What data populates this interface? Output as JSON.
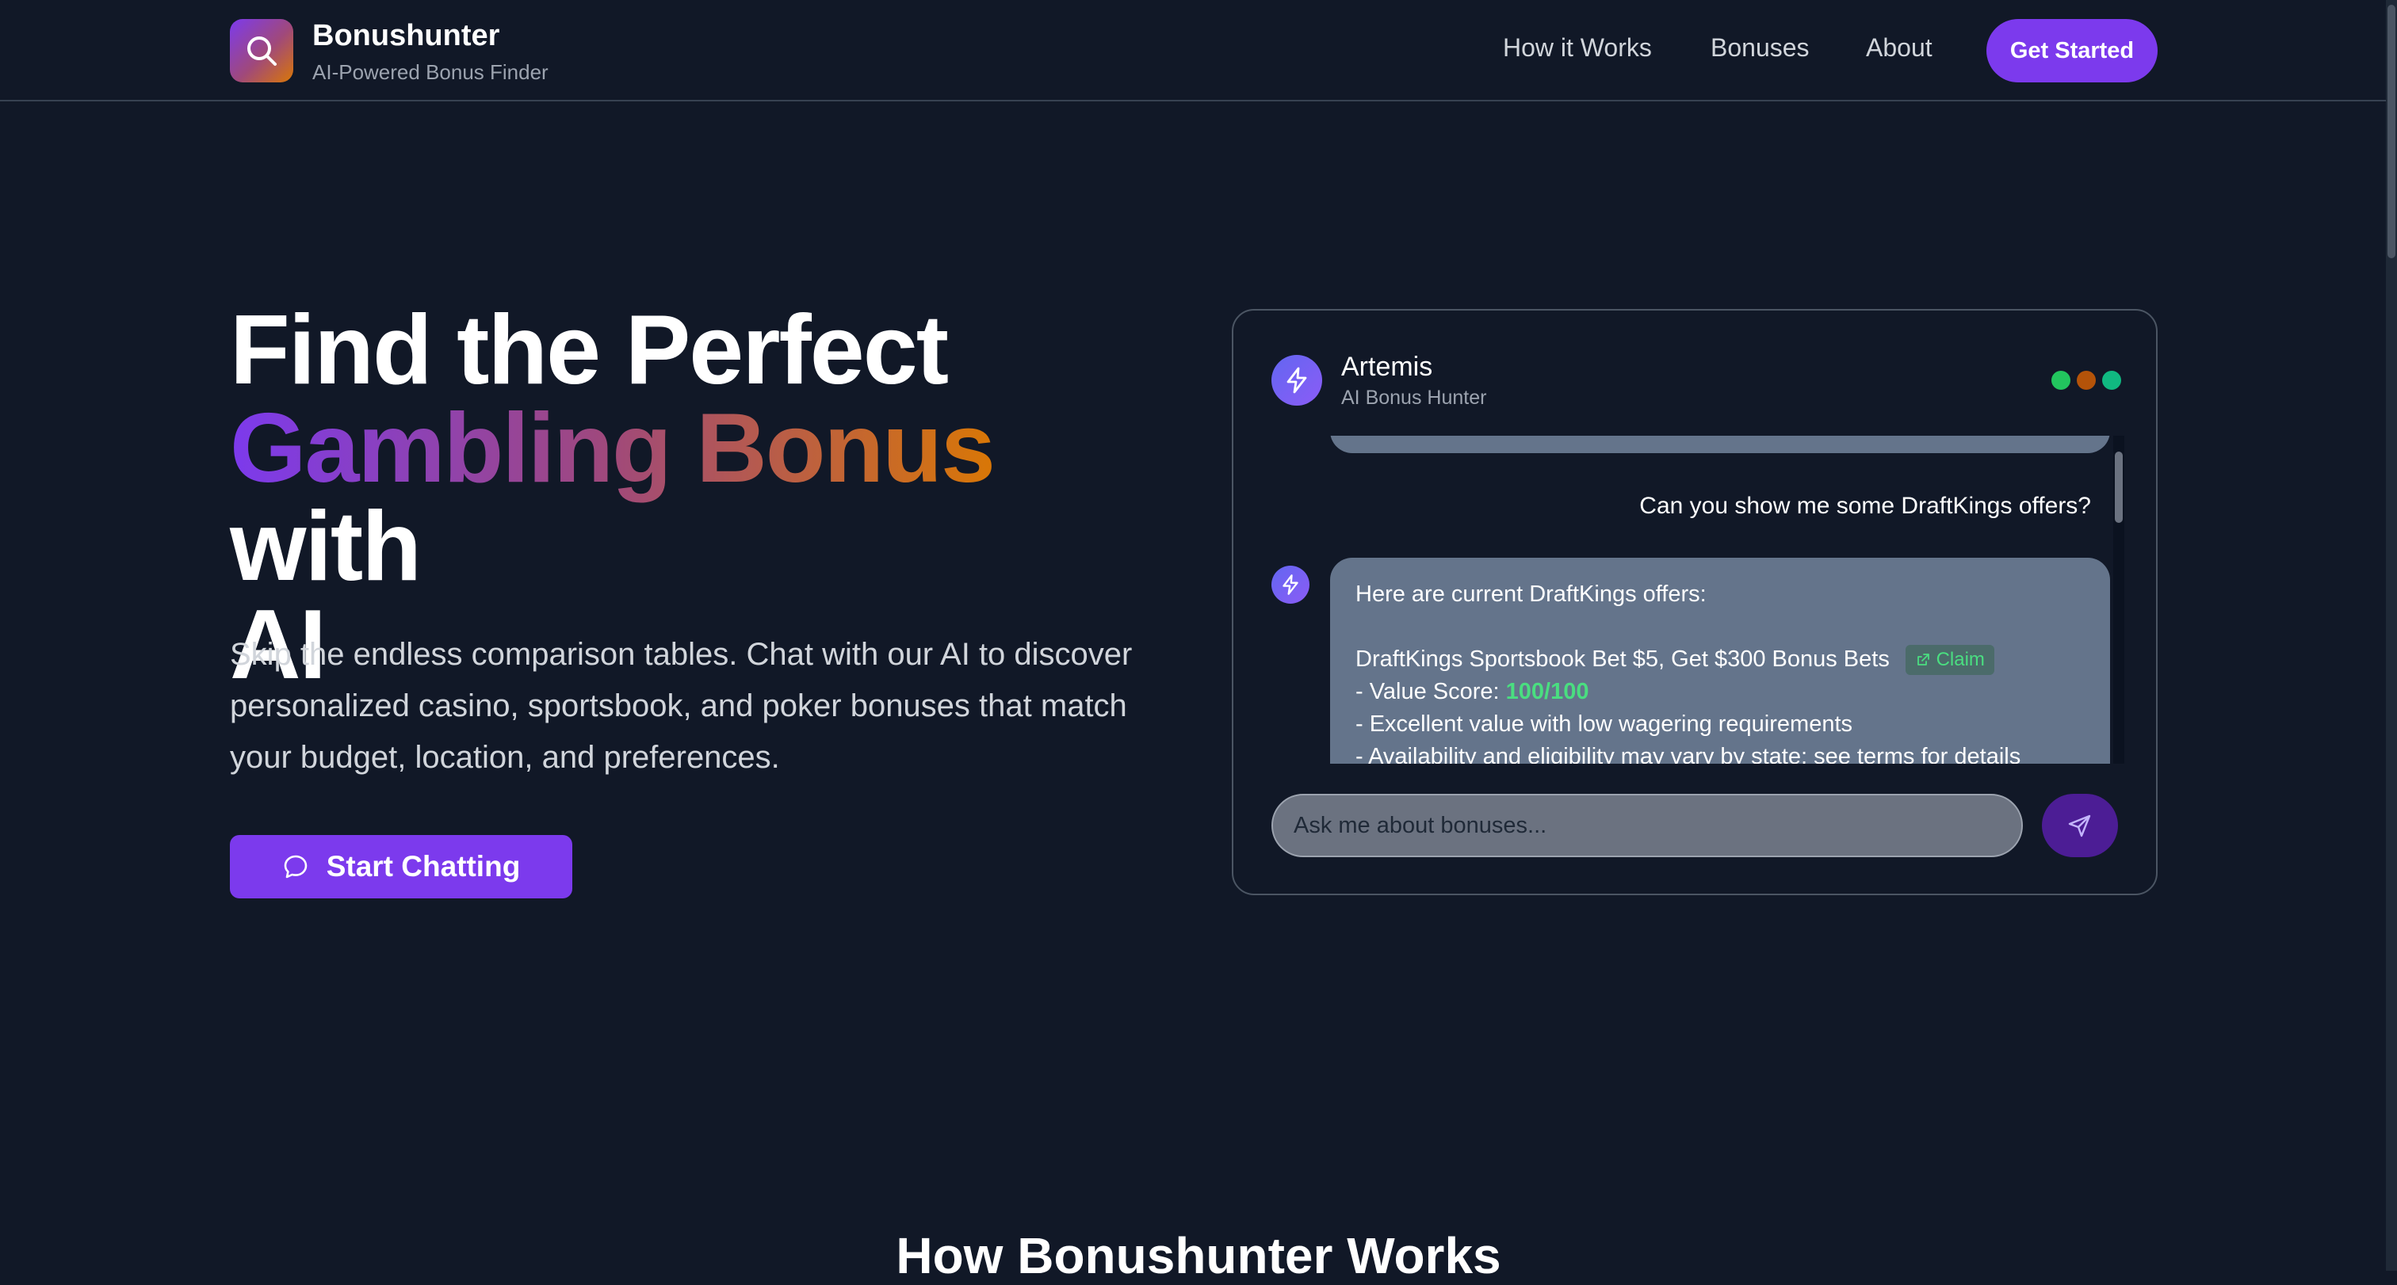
{
  "nav": {
    "brand_name": "Bonushunter",
    "brand_tagline": "AI-Powered Bonus Finder",
    "logo_icon": "search-icon",
    "links": [
      "How it Works",
      "Bonuses",
      "About"
    ],
    "cta_label": "Get Started"
  },
  "hero": {
    "title_line1": "Find the Perfect",
    "title_highlight": "Gambling Bonus",
    "title_line2_rest": "with",
    "title_line3": "AI",
    "subtitle": "Skip the endless comparison tables. Chat with our AI to discover personalized casino, sportsbook, and poker bonuses that match your budget, location, and preferences.",
    "cta_label": "Start Chatting",
    "cta_icon": "chat-bubble-icon",
    "gradient_colors": [
      "#7c3aed",
      "#a0497a",
      "#d97706"
    ]
  },
  "chat": {
    "agent_name": "Artemis",
    "agent_role": "AI Bonus Hunter",
    "status_dots": [
      "#22c55e",
      "#b45309",
      "#10b981"
    ],
    "user_message": "Can you show me some DraftKings offers?",
    "bot_intro": "Here are current DraftKings offers:",
    "offer_title": "DraftKings Sportsbook Bet $5, Get $300 Bonus Bets",
    "claim_label": "Claim",
    "value_score_label": "- Value Score: ",
    "value_score": "100/100",
    "point1": "- Excellent value with low wagering requirements",
    "point2": "- Availability and eligibility may vary by state; see terms for details",
    "input_placeholder": "Ask me about bonuses...",
    "send_icon": "send-icon"
  },
  "section": {
    "title": "How Bonushunter Works"
  },
  "colors": {
    "background": "#111827",
    "accent": "#7c3aed",
    "score": "#4ade80"
  }
}
